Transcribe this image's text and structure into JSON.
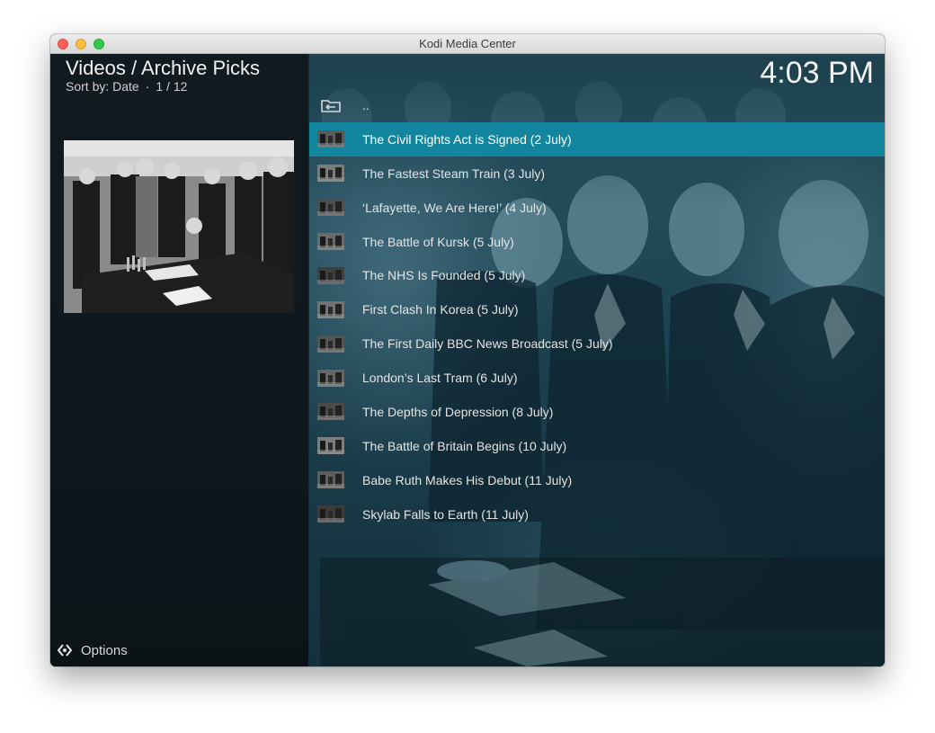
{
  "window": {
    "title": "Kodi Media Center"
  },
  "header": {
    "title": "Videos / Archive Picks",
    "sort_label": "Sort by: Date",
    "separator": "·",
    "position": "1 / 12"
  },
  "clock": "4:03 PM",
  "preview": {
    "icon": "archive-photo-thumbnail"
  },
  "list": {
    "parent_label": "..",
    "parent_icon": "folder-back-icon",
    "selected_index": 0,
    "items": [
      {
        "label": "The Civil Rights Act is Signed (2 July)",
        "thumb": "civil-rights-thumb"
      },
      {
        "label": "The Fastest Steam Train (3 July)",
        "thumb": "steam-train-thumb"
      },
      {
        "label": "‘Lafayette, We Are Here!’ (4 July)",
        "thumb": "lafayette-thumb"
      },
      {
        "label": "The Battle of Kursk (5 July)",
        "thumb": "kursk-thumb"
      },
      {
        "label": "The NHS Is Founded (5 July)",
        "thumb": "nhs-thumb"
      },
      {
        "label": "First Clash In Korea (5 July)",
        "thumb": "korea-thumb"
      },
      {
        "label": "The First Daily BBC News Broadcast (5 July)",
        "thumb": "bbc-news-thumb"
      },
      {
        "label": "London’s Last Tram (6 July)",
        "thumb": "london-tram-thumb"
      },
      {
        "label": "The Depths of Depression (8 July)",
        "thumb": "depression-thumb"
      },
      {
        "label": "The Battle of Britain Begins (10 July)",
        "thumb": "battle-of-britain-thumb"
      },
      {
        "label": "Babe Ruth Makes His Debut (11 July)",
        "thumb": "babe-ruth-thumb"
      },
      {
        "label": "Skylab Falls to Earth (11 July)",
        "thumb": "skylab-thumb"
      }
    ]
  },
  "footer": {
    "options_label": "Options",
    "options_icon": "options-icon"
  },
  "colors": {
    "selection": "#12869f",
    "panel": "#111a1f",
    "background": "#1d4250"
  }
}
